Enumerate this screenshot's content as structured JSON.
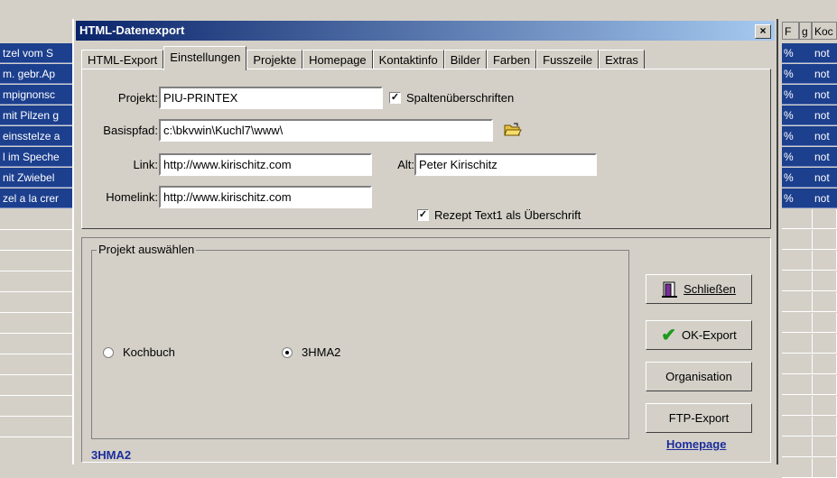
{
  "background": {
    "left_rows": [
      "tzel vom S",
      "m. gebr.Ap",
      "mpignonsc",
      "mit Pilzen g",
      "einsstelze a",
      "l im Speche",
      "nit Zwiebel",
      "zel a la crer"
    ],
    "right_headers": [
      "F",
      "g",
      "Koc"
    ],
    "right_pct": "%",
    "right_val": "not"
  },
  "dialog": {
    "title": "HTML-Datenexport",
    "close_label": "×",
    "tabs": [
      "HTML-Export",
      "Einstellungen",
      "Projekte",
      "Homepage",
      "Kontaktinfo",
      "Bilder",
      "Farben",
      "Fusszeile",
      "Extras"
    ],
    "active_tab": "Einstellungen",
    "settings": {
      "projekt_label": "Projekt:",
      "projekt_value": "PIU-PRINTEX",
      "spalten_label": "Spaltenüberschriften",
      "spalten_checked": true,
      "basispfad_label": "Basispfad:",
      "basispfad_value": "c:\\bkvwin\\Kuchl7\\www\\",
      "link_label": "Link:",
      "link_value": "http://www.kirischitz.com",
      "alt_label": "Alt:",
      "alt_value": "Peter Kirischitz",
      "homelink_label": "Homelink:",
      "homelink_value": "http://www.kirischitz.com",
      "rezept_label": "Rezept Text1 als Überschrift",
      "rezept_checked": true
    },
    "project_group": {
      "label": "Projekt auswählen",
      "options": [
        "Kochbuch",
        "3HMA2"
      ],
      "selected": "3HMA2"
    },
    "buttons": {
      "schliessen": "Schließen",
      "ok_export": "OK-Export",
      "organisation": "Organisation",
      "ftp_export": "FTP-Export"
    },
    "homepage_link": "Homepage",
    "status": "3HMA2"
  }
}
